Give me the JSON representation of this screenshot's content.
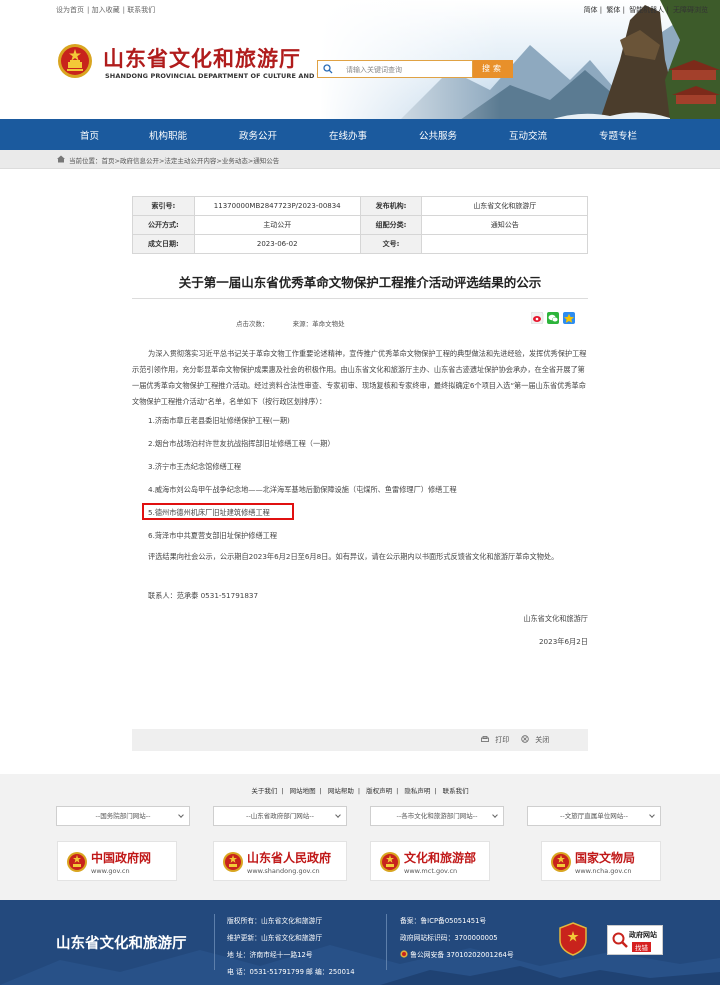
{
  "top_links": {
    "set_home": "设为首页",
    "add_fav": "加入收藏",
    "contact": "联系我们",
    "simplified": "简体",
    "traditional": "繁体",
    "robot": "智能机器人",
    "accessible": "无障碍浏览"
  },
  "site": {
    "name": "山东省文化和旅游厅",
    "english": "SHANDONG PROVINCIAL DEPARTMENT OF CULTURE AND TOURISM"
  },
  "search": {
    "placeholder": "请输入关键词查询",
    "button": "搜索"
  },
  "nav": {
    "items": [
      "首页",
      "机构职能",
      "政务公开",
      "在线办事",
      "公共服务",
      "互动交流",
      "专题专栏"
    ]
  },
  "breadcrumb": "当前位置：首页>政府信息公开>法定主动公开内容>业务动态>通知公告",
  "meta": {
    "index_label": "索引号:",
    "index_value": "11370000MB2847723P/2023-00834",
    "org_label": "发布机构:",
    "org_value": "山东省文化和旅游厅",
    "mode_label": "公开方式:",
    "mode_value": "主动公开",
    "category_label": "组配分类:",
    "category_value": "通知公告",
    "date_label": "成文日期:",
    "date_value": "2023-06-02",
    "doc_label": "文号:",
    "doc_value": ""
  },
  "article": {
    "title": "关于第一届山东省优秀革命文物保护工程推介活动评选结果的公示",
    "views": "点击次数：",
    "source": "来源：革命文物处",
    "intro": "为深入贯彻落实习近平总书记关于革命文物工作重要论述精神，宣传推广优秀革命文物保护工程的典型做法和先进经验，发挥优秀保护工程示范引领作用，充分彰显革命文物保护成果惠及社会的积极作用。由山东省文化和旅游厅主办、山东省古迹遗址保护协会承办，在全省开展了第一届优秀革命文物保护工程推介活动。经过资料合法性审查、专家初审、现场复核和专家终审，最终拟确定6个项目入选“第一届山东省优秀革命文物保护工程推介活动”名单，名单如下（按行政区划排序）：",
    "items": [
      "1.济南市章丘老县委旧址修缮保护工程(一期)",
      "2.烟台市战场泊村许世友抗战指挥部旧址修缮工程（一期）",
      "3.济宁市王杰纪念馆修缮工程",
      "4.威海市刘公岛甲午战争纪念地——北洋海军基地后勤保障设施（屯煤所、鱼雷修理厂）修缮工程",
      "5.德州市德州机床厂旧址建筑修缮工程",
      "6.菏泽市中共夏营支部旧址保护修缮工程"
    ],
    "closing": "评选结果向社会公示，公示期自2023年6月2日至6月8日。如有异议，请在公示期内以书面形式反馈省文化和旅游厅革命文物处。",
    "contact": "联系人：范承泰  0531-51791837",
    "sign_org": "山东省文化和旅游厅",
    "sign_date": "2023年6月2日",
    "print": "打印",
    "close": "关闭"
  },
  "footer": {
    "links": [
      "关于我们",
      "网站地图",
      "网站帮助",
      "版权声明",
      "隐私声明",
      "联系我们"
    ],
    "selects": [
      "--国务院部门网站--",
      "--山东省政府部门网站--",
      "--各市文化和旅游部门网站--",
      "--文旅厅直属单位网站--"
    ],
    "logos": [
      {
        "name": "中国政府网",
        "url": "www.gov.cn"
      },
      {
        "name": "山东省人民政府",
        "url": "www.shandong.gov.cn"
      },
      {
        "name": "文化和旅游部",
        "url": "www.mct.gov.cn"
      },
      {
        "name": "国家文物局",
        "url": "www.ncha.gov.cn"
      }
    ],
    "title": "山东省文化和旅游厅",
    "copyright": "版权所有：山东省文化和旅游厅",
    "maintain": "维护更新：山东省文化和旅游厅",
    "address": "地  址：济南市经十一路12号",
    "phone": "电  话：0531-51791799 邮 编：250014",
    "icp": "备案：鲁ICP备05051451号",
    "site_code": "政府网站标识码：3700000005",
    "police": "鲁公网安备 37010202001264号",
    "jiucuo_1": "政府网站",
    "jiucuo_2": "找错"
  },
  "colors": {
    "nav_blue": "#1b5a9e",
    "brand_red": "#b01c1c",
    "search_orange": "#e8902a",
    "footer_blue": "#23497d"
  }
}
